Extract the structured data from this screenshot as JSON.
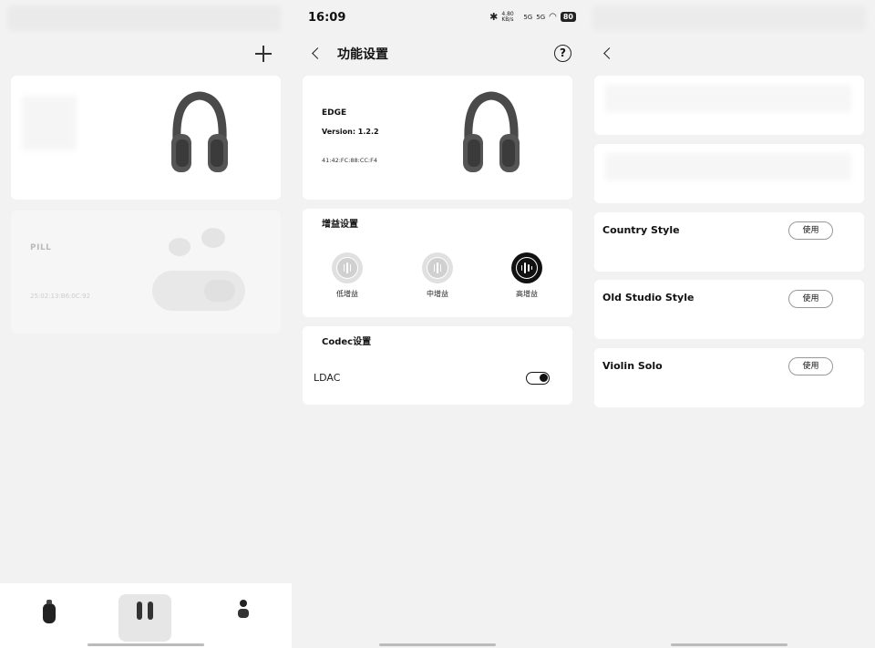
{
  "left_panel": {
    "card2_label": "PILL",
    "card2_mac": "25:02:13:B6:0C:92"
  },
  "status_bar": {
    "time": "16:09",
    "net_speed": "4.80 KB/s",
    "signal1": "5G",
    "signal2": "5G",
    "battery": "80"
  },
  "middle_panel": {
    "title": "功能设置",
    "help": "?",
    "device": {
      "name": "EDGE",
      "version": "Version: 1.2.2",
      "mac": "41:42:FC:88:CC:F4"
    },
    "gain_section": {
      "title": "增益设置",
      "options": [
        {
          "label": "低增益",
          "active": false
        },
        {
          "label": "中增益",
          "active": false
        },
        {
          "label": "高增益",
          "active": true
        }
      ]
    },
    "codec_section": {
      "title": "Codec设置",
      "item_label": "LDAC",
      "enabled": true
    }
  },
  "right_panel": {
    "styles": [
      {
        "name": "Country Style",
        "button": "使用"
      },
      {
        "name": "Old Studio Style",
        "button": "使用"
      },
      {
        "name": "Violin Solo",
        "button": "使用"
      }
    ]
  }
}
